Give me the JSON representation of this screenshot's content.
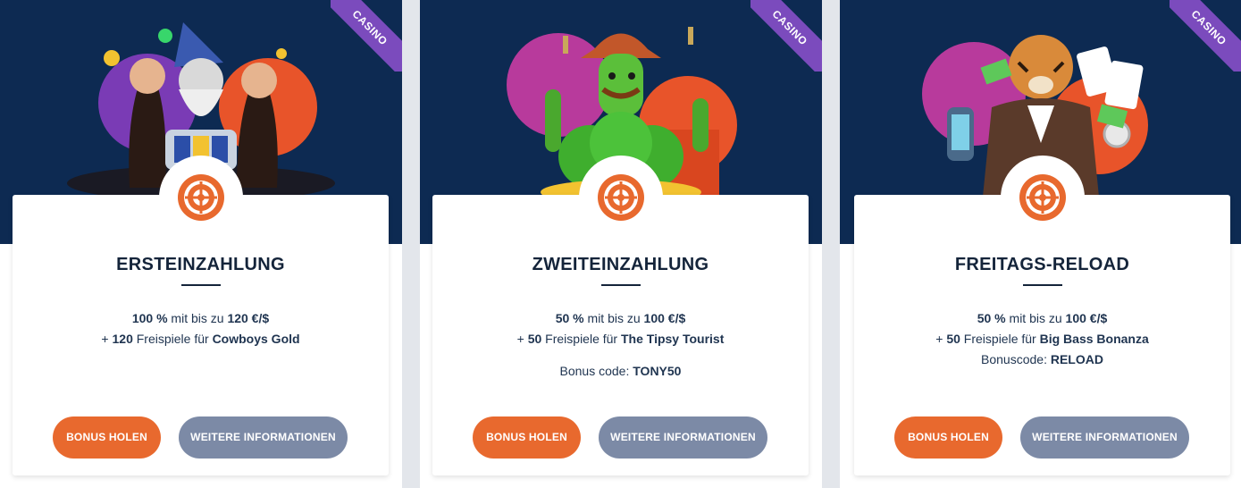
{
  "cards": [
    {
      "ribbon": "CASINO",
      "title": "ERSTEINZAHLUNG",
      "line1": {
        "pct": "100 %",
        "mid": " mit bis zu ",
        "amount": "120 €/$"
      },
      "line2": {
        "prefix": "+ ",
        "spins": "120",
        "mid": " Freispiele für ",
        "game": "Cowboys Gold"
      },
      "code": {
        "label": "",
        "value": ""
      },
      "bonus_button": "BONUS HOLEN",
      "info_button": "WEITERE INFORMATIONEN"
    },
    {
      "ribbon": "CASINO",
      "title": "ZWEITEINZAHLUNG",
      "line1": {
        "pct": "50 %",
        "mid": " mit bis zu ",
        "amount": "100 €/$"
      },
      "line2": {
        "prefix": "+ ",
        "spins": "50",
        "mid": " Freispiele für ",
        "game": "The Tipsy Tourist"
      },
      "code": {
        "label": "Bonus code: ",
        "value": "TONY50"
      },
      "bonus_button": "BONUS HOLEN",
      "info_button": "WEITERE INFORMATIONEN"
    },
    {
      "ribbon": "CASINO",
      "title": "FREITAGS-RELOAD",
      "line1": {
        "pct": "50 %",
        "mid": " mit bis zu ",
        "amount": "100 €/$"
      },
      "line2": {
        "prefix": "+ ",
        "spins": "50",
        "mid": " Freispiele für ",
        "game": "Big Bass Bonanza"
      },
      "code": {
        "label": "Bonuscode: ",
        "value": "RELOAD"
      },
      "bonus_button": "BONUS HOLEN",
      "info_button": "WEITERE INFORMATIONEN"
    }
  ],
  "colors": {
    "hero_bg": "#0d2a52",
    "ribbon": "#7b4bbd",
    "bonus_button": "#e8692e",
    "info_button": "#7c8aa6",
    "roulette_icon": "#e8692e"
  },
  "icons": [
    "roulette-wheel-icon"
  ]
}
